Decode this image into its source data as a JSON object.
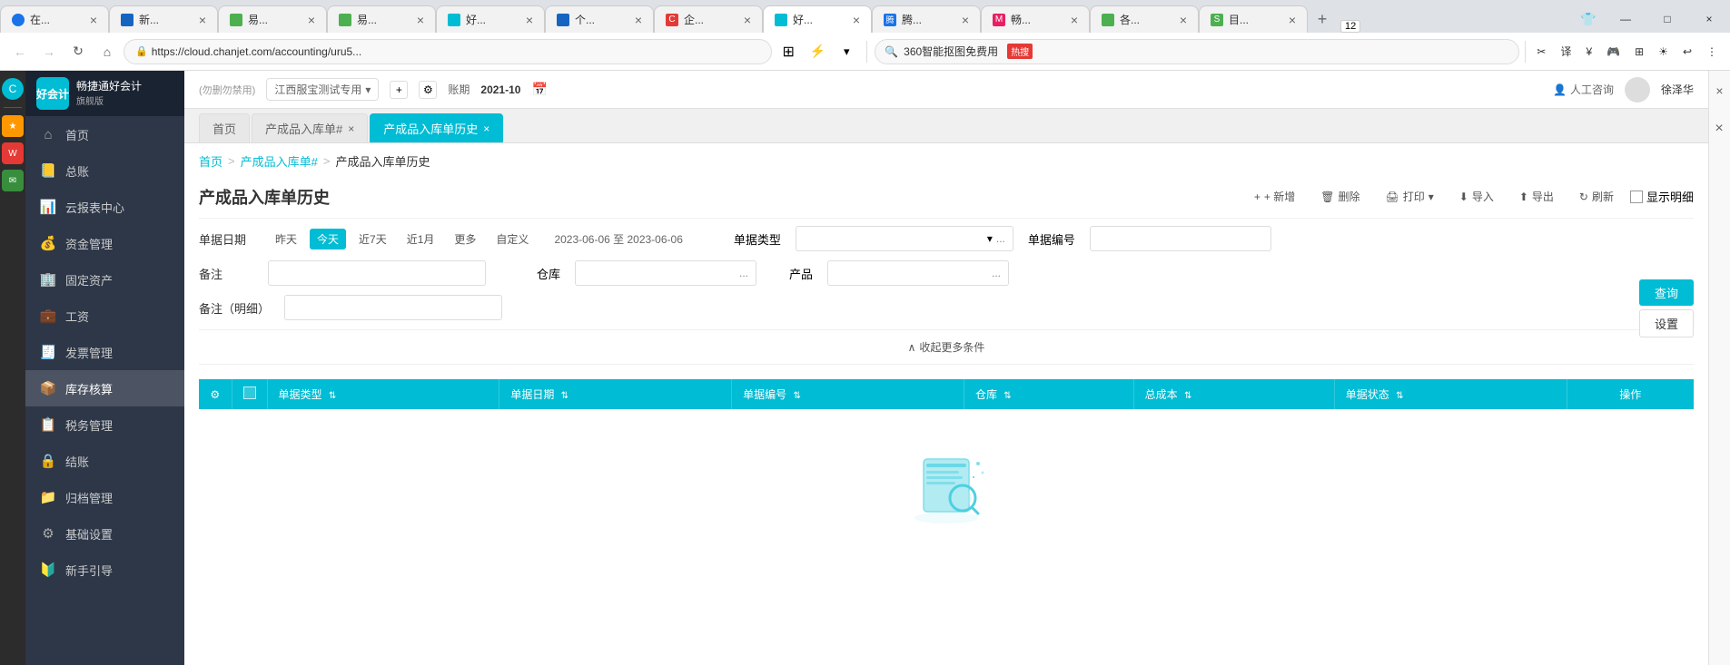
{
  "browser": {
    "tabs": [
      {
        "id": "t1",
        "label": "在...",
        "icon_bg": "#1a73e8",
        "icon_text": "◉",
        "active": false
      },
      {
        "id": "t2",
        "label": "新...",
        "icon_bg": "#1a73e8",
        "icon_text": "📄",
        "active": false
      },
      {
        "id": "t3",
        "label": "易...",
        "icon_bg": "#4caf50",
        "icon_text": "易",
        "active": false
      },
      {
        "id": "t4",
        "label": "易...",
        "icon_bg": "#4caf50",
        "icon_text": "易",
        "active": false
      },
      {
        "id": "t5",
        "label": "好...",
        "icon_bg": "#00bcd4",
        "icon_text": "☁",
        "active": false
      },
      {
        "id": "t6",
        "label": "个...",
        "icon_bg": "#1a73e8",
        "icon_text": "📄",
        "active": false
      },
      {
        "id": "t7",
        "label": "企...",
        "icon_bg": "#e53935",
        "icon_text": "C",
        "active": false
      },
      {
        "id": "t8",
        "label": "好...",
        "icon_bg": "#00bcd4",
        "icon_text": "☁",
        "active": true,
        "closable": true
      },
      {
        "id": "t9",
        "label": "腾...",
        "icon_bg": "#1a73e8",
        "icon_text": "腾",
        "active": false
      },
      {
        "id": "t10",
        "label": "畅...",
        "icon_bg": "#e91e63",
        "icon_text": "M",
        "active": false
      },
      {
        "id": "t11",
        "label": "各...",
        "icon_bg": "#4caf50",
        "icon_text": "表",
        "active": false
      },
      {
        "id": "t12",
        "label": "目...",
        "icon_bg": "#4caf50",
        "icon_text": "S",
        "active": false
      }
    ],
    "tab_count": "12",
    "address": "https://cloud.chanjet.com/accounting/uru5...",
    "search_placeholder": "360智能抠图免费用",
    "search_hot_label": "热搜"
  },
  "sidebar": {
    "brand_text": "畅捷通好会计",
    "brand_sub": "旗舰版",
    "items": [
      {
        "id": "home",
        "label": "首页",
        "icon": "⌂"
      },
      {
        "id": "ledger",
        "label": "总账",
        "icon": "📒"
      },
      {
        "id": "report",
        "label": "云报表中心",
        "icon": "📊"
      },
      {
        "id": "funds",
        "label": "资金管理",
        "icon": "💰"
      },
      {
        "id": "fixed",
        "label": "固定资产",
        "icon": "🏢"
      },
      {
        "id": "salary",
        "label": "工资",
        "icon": "💼"
      },
      {
        "id": "invoice",
        "label": "发票管理",
        "icon": "🧾"
      },
      {
        "id": "inventory",
        "label": "库存核算",
        "icon": "📦",
        "active": true
      },
      {
        "id": "tax",
        "label": "税务管理",
        "icon": "📋"
      },
      {
        "id": "settlement",
        "label": "结账",
        "icon": "🔒"
      },
      {
        "id": "archive",
        "label": "归档管理",
        "icon": "📁"
      },
      {
        "id": "basic",
        "label": "基础设置",
        "icon": "⚙"
      },
      {
        "id": "newvoucher",
        "label": "新手引导",
        "icon": "🔰"
      }
    ]
  },
  "topbar": {
    "warning_label": "(勿删勿禁用)",
    "company_name": "江西服宝测试专用",
    "period_label": "账期",
    "period_value": "2021-10",
    "service_label": "人工咨询",
    "user_name": "徐泽华"
  },
  "page_tabs": [
    {
      "id": "pt1",
      "label": "首页",
      "active": false,
      "closable": false
    },
    {
      "id": "pt2",
      "label": "产成品入库单#",
      "active": false,
      "closable": true
    },
    {
      "id": "pt3",
      "label": "产成品入库单历史",
      "active": true,
      "closable": true
    }
  ],
  "page": {
    "title": "产成品入库单历史",
    "breadcrumb": [
      "首页",
      "产成品入库单#",
      "产成品入库单历史"
    ],
    "actions": {
      "add": "+ 新增",
      "delete": "删除",
      "print": "打印",
      "import": "导入",
      "export": "导出",
      "refresh": "刷新",
      "show_cols": "显示明细"
    }
  },
  "filter": {
    "date_label": "单据日期",
    "date_options": [
      "昨天",
      "今天",
      "近7天",
      "近1月",
      "更多",
      "自定义"
    ],
    "date_active": "今天",
    "date_range": "2023-06-06 至 2023-06-06",
    "doc_type_label": "单据类型",
    "doc_type_placeholder": "",
    "doc_type_dots": "...",
    "doc_num_label": "单据编号",
    "remark_label": "备注",
    "warehouse_label": "仓库",
    "warehouse_dots": "...",
    "product_label": "产品",
    "product_dots": "...",
    "remark_detail_label": "备注（明细）",
    "collapse_label": "收起更多条件",
    "query_btn": "查询",
    "settings_btn": "设置"
  },
  "table": {
    "columns": [
      {
        "id": "settings",
        "label": "⚙",
        "sortable": false
      },
      {
        "id": "checkbox",
        "label": "",
        "sortable": false
      },
      {
        "id": "doc_type",
        "label": "单据类型",
        "sortable": true
      },
      {
        "id": "doc_date",
        "label": "单据日期",
        "sortable": true
      },
      {
        "id": "doc_num",
        "label": "单据编号",
        "sortable": true
      },
      {
        "id": "warehouse",
        "label": "仓库",
        "sortable": true
      },
      {
        "id": "total_cost",
        "label": "总成本",
        "sortable": true
      },
      {
        "id": "doc_status",
        "label": "单据状态",
        "sortable": true
      },
      {
        "id": "actions",
        "label": "操作",
        "sortable": false
      }
    ],
    "rows": []
  },
  "empty_state": {
    "visible": true
  },
  "colors": {
    "primary": "#00bcd4",
    "sidebar_bg": "#2d3748",
    "sidebar_header_bg": "#1a2332",
    "table_header_bg": "#00bcd4",
    "active_tab_bg": "#00bcd4"
  },
  "icons": {
    "home": "⌂",
    "gear": "⚙",
    "sort": "⇅",
    "collapse": "∧",
    "calendar": "📅",
    "plus": "+",
    "trash": "🗑",
    "print": "🖨",
    "import": "⬇",
    "export": "⬆",
    "refresh": "↻",
    "chevron_down": "▾",
    "close": "×",
    "search": "🔍",
    "user": "👤",
    "chat": "💬"
  }
}
